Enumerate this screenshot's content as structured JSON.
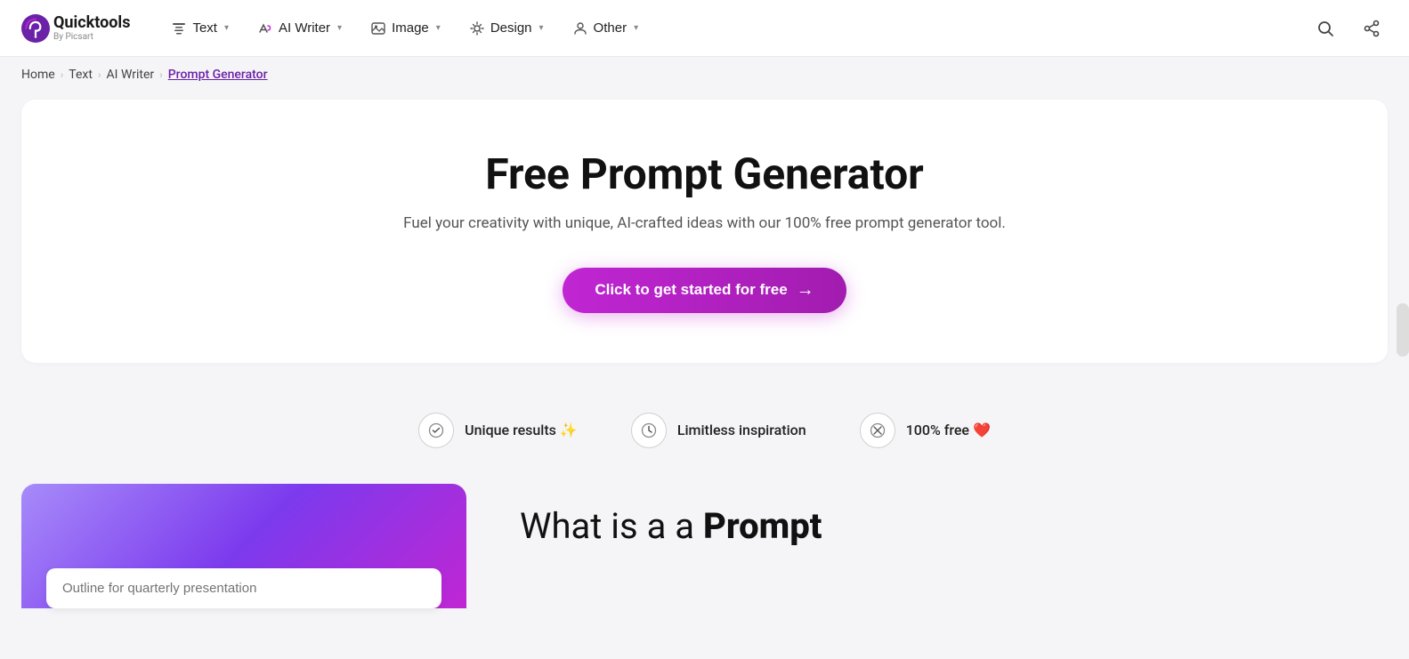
{
  "logo": {
    "main": "Quicktools",
    "sub": "By Picsart"
  },
  "nav": {
    "items": [
      {
        "id": "text",
        "label": "Text",
        "icon": "T"
      },
      {
        "id": "ai-writer",
        "label": "AI Writer",
        "icon": "✦"
      },
      {
        "id": "image",
        "label": "Image",
        "icon": "🖼"
      },
      {
        "id": "design",
        "label": "Design",
        "icon": "⚙"
      },
      {
        "id": "other",
        "label": "Other",
        "icon": "👤"
      }
    ]
  },
  "breadcrumb": {
    "items": [
      "Home",
      "Text",
      "AI Writer",
      "Prompt Generator"
    ],
    "active_index": 3
  },
  "hero": {
    "title": "Free Prompt Generator",
    "subtitle": "Fuel your creativity with unique, AI-crafted ideas with our 100% free prompt generator tool.",
    "cta_label": "Click to get started for free",
    "cta_arrow": "→"
  },
  "features": [
    {
      "id": "unique",
      "label": "Unique results ✨",
      "icon": "○"
    },
    {
      "id": "limitless",
      "label": "Limitless inspiration",
      "icon": "⏱"
    },
    {
      "id": "free",
      "label": "100% free ❤️",
      "icon": "⊘"
    }
  ],
  "bottom": {
    "search_placeholder": "Outline for quarterly presentation",
    "what_is_label": "What is a",
    "what_is_bold": "Prompt"
  }
}
